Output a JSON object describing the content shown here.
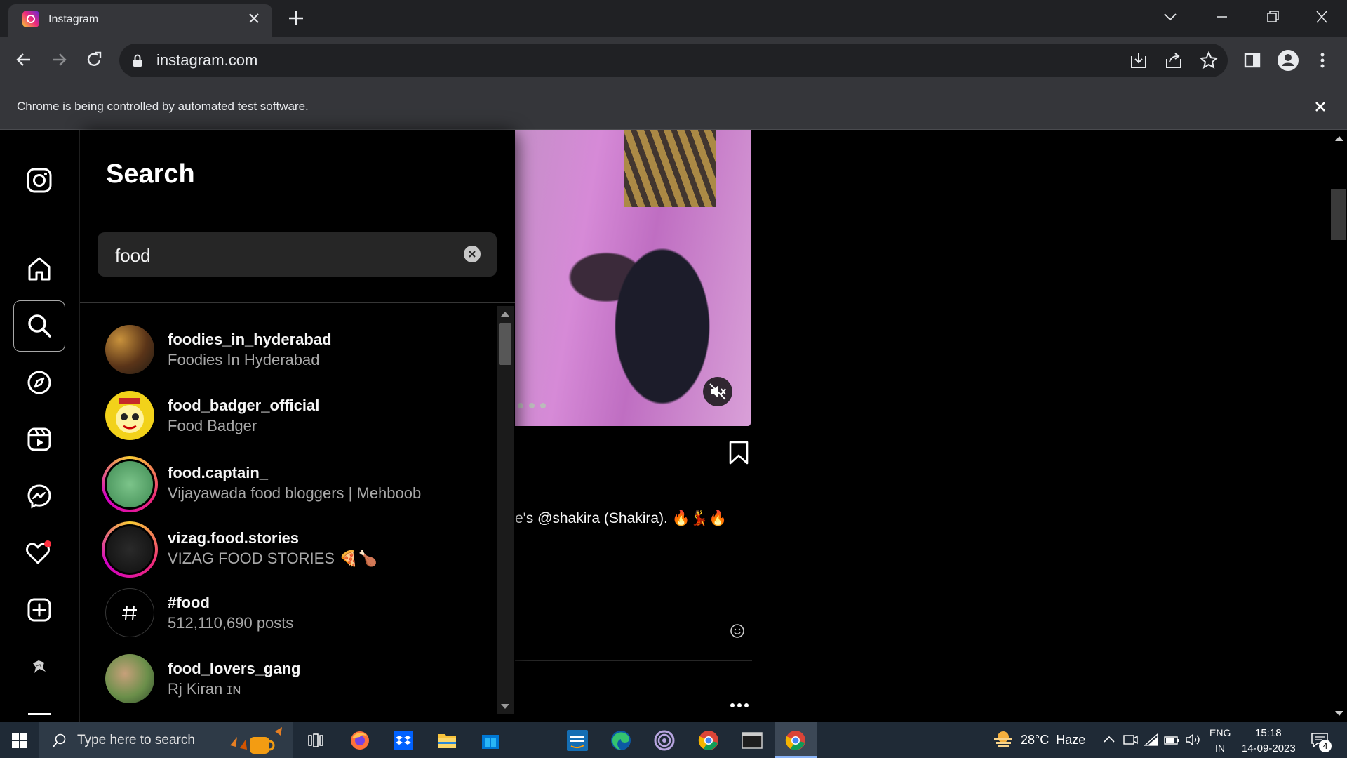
{
  "browser": {
    "tab_title": "Instagram",
    "url": "instagram.com",
    "infobar_text": "Chrome is being controlled by automated test software."
  },
  "search": {
    "title": "Search",
    "query": "food",
    "results": [
      {
        "username": "foodies_in_hyderabad",
        "subtitle": "Foodies In Hyderabad"
      },
      {
        "username": "food_badger_official",
        "subtitle": "Food Badger"
      },
      {
        "username": "food.captain_",
        "subtitle": "Vijayawada food bloggers | Mehboob"
      },
      {
        "username": "vizag.food.stories",
        "subtitle": "VIZAG FOOD STORIES 🍕🍗"
      },
      {
        "username": "#food",
        "subtitle": "512,110,690 posts"
      },
      {
        "username": "food_lovers_gang",
        "subtitle": "Rj Kiran ɪɴ"
      }
    ]
  },
  "post": {
    "caption": "e's @shakira (Shakira). 🔥💃🔥"
  },
  "taskbar": {
    "search_placeholder": "Type here to search",
    "weather": "28°C  Haze",
    "lang_line1": "ENG",
    "lang_line2": "IN",
    "time": "15:18",
    "date": "14-09-2023",
    "notification_count": "4"
  },
  "colors": {
    "accent_red": "#ff3040",
    "story_ring_start": "#f9ce34",
    "story_ring_end": "#d300c5"
  }
}
